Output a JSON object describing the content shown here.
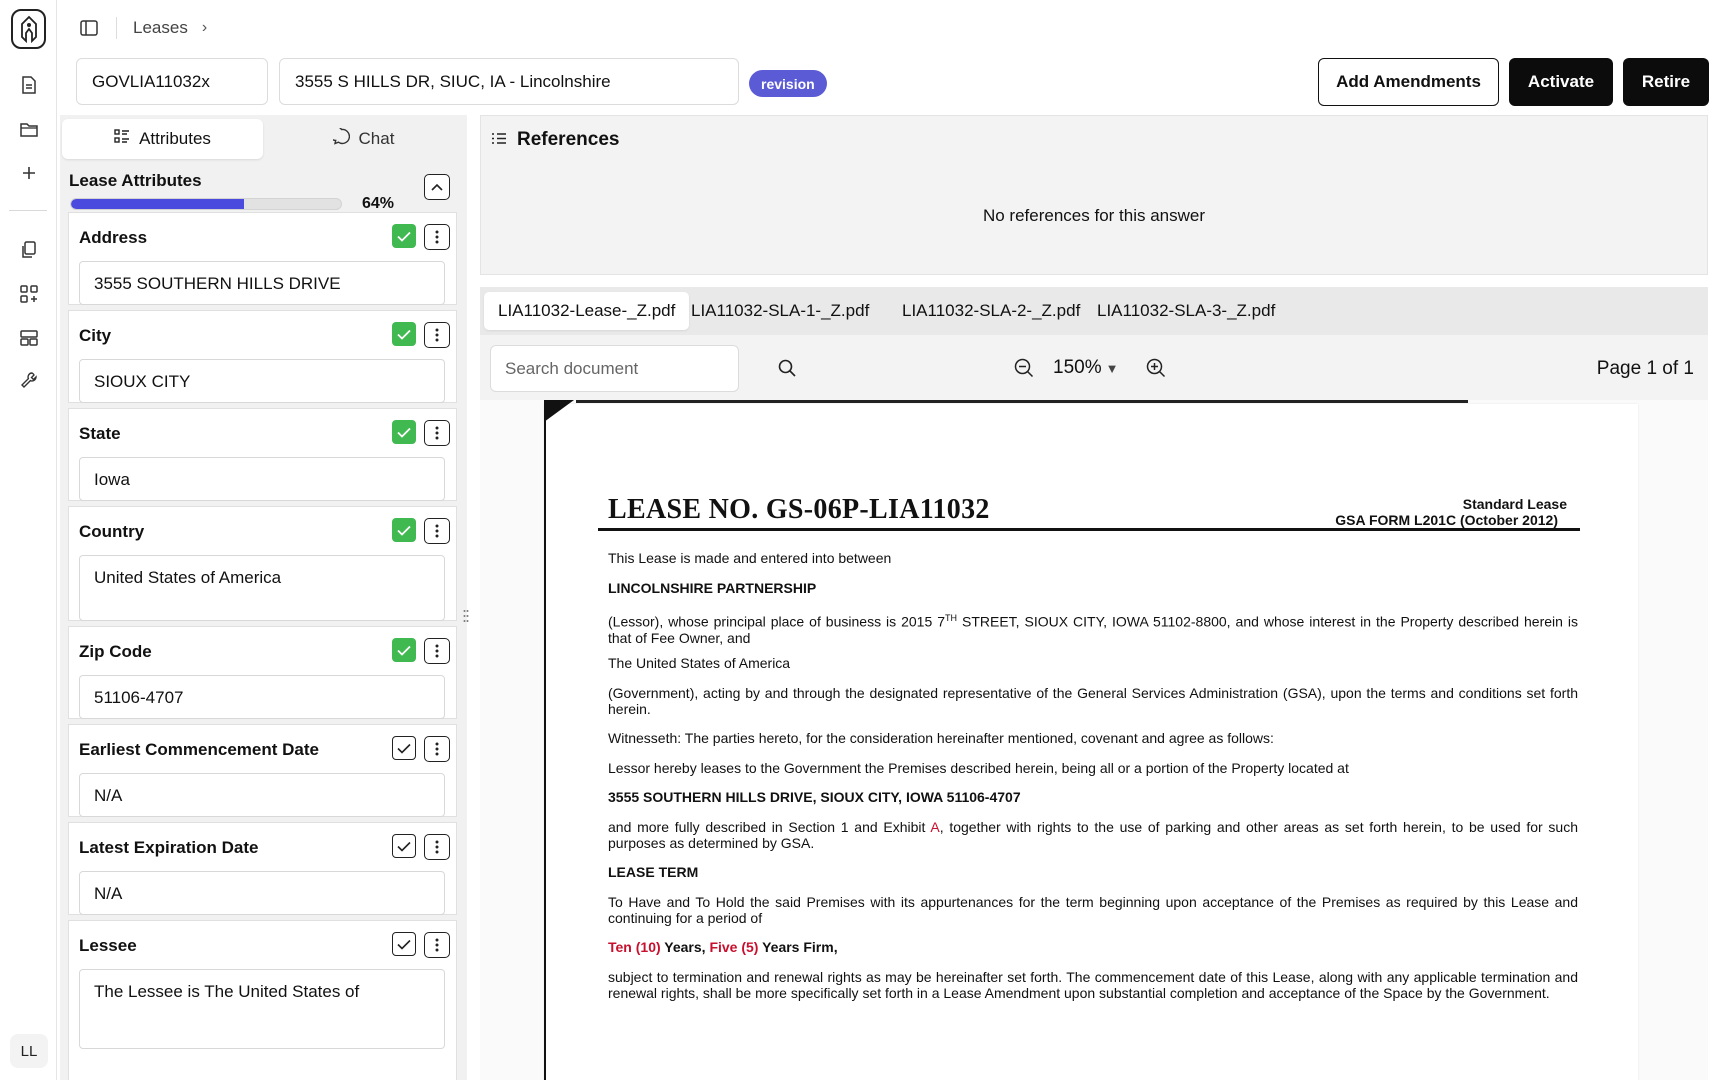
{
  "breadcrumb": {
    "root": "Leases"
  },
  "header": {
    "lease_code": "GOVLIA11032x",
    "property": "3555 S HILLS DR, SIUC, IA - Lincolnshire",
    "status_badge": "revision",
    "actions": {
      "add_amendments": "Add Amendments",
      "activate": "Activate",
      "retire": "Retire"
    }
  },
  "user": {
    "initials": "LL"
  },
  "left_panel": {
    "tabs": {
      "attributes": "Attributes",
      "chat": "Chat"
    },
    "section_title": "Lease Attributes",
    "progress": {
      "percent": 64,
      "label": "64%"
    },
    "fields": [
      {
        "label": "Address",
        "value": "3555 SOUTHERN HILLS DRIVE",
        "verified": true
      },
      {
        "label": "City",
        "value": "SIOUX CITY",
        "verified": true
      },
      {
        "label": "State",
        "value": "Iowa",
        "verified": true
      },
      {
        "label": "Country",
        "value": "United States of America",
        "verified": true
      },
      {
        "label": "Zip Code",
        "value": "51106-4707",
        "verified": true
      },
      {
        "label": "Earliest Commencement Date",
        "value": "N/A",
        "verified": false
      },
      {
        "label": "Latest Expiration Date",
        "value": "N/A",
        "verified": false
      },
      {
        "label": "Lessee",
        "value": "The Lessee is The United States of",
        "verified": false
      }
    ]
  },
  "references": {
    "title": "References",
    "empty_message": "No references for this answer"
  },
  "documents": {
    "tabs": [
      "LIA11032-Lease-_Z.pdf",
      "LIA11032-SLA-1-_Z.pdf",
      "LIA11032-SLA-2-_Z.pdf",
      "LIA11032-SLA-3-_Z.pdf"
    ],
    "active_tab": 0,
    "search_placeholder": "Search document",
    "zoom": "150%",
    "page_info": "Page 1 of 1"
  },
  "document_page": {
    "lease_no": "LEASE NO. GS-06P-LIA11032",
    "form_line1": "Standard Lease",
    "form_line2": "GSA FORM L201C (October 2012)",
    "p1": "This Lease is made and entered into between",
    "p2": "LINCOLNSHIRE PARTNERSHIP",
    "p3_a": "(Lessor), whose principal place of business is 2015 7",
    "p3_sup": "TH",
    "p3_b": " STREET, SIOUX CITY, IOWA 51102-8800, and whose interest in the Property described herein is that of Fee Owner, and",
    "p4": "The United States of America",
    "p5": "(Government), acting by and through the designated representative of the General Services Administration (GSA), upon the terms and conditions set forth herein.",
    "p6": "Witnesseth: The parties hereto, for the consideration hereinafter mentioned, covenant and agree as follows:",
    "p7": "Lessor hereby leases to the Government the Premises described herein, being all or a portion of the Property located at",
    "p8": "3555 SOUTHERN HILLS DRIVE, SIOUX CITY, IOWA 51106-4707",
    "p9_a": "and more fully described in Section 1 and Exhibit ",
    "p9_red": "A",
    "p9_b": ", together with rights to the use of parking and other areas as set forth herein, to be used for such purposes as determined by GSA.",
    "p10": "LEASE TERM",
    "p11": "To Have and To Hold the said Premises with its appurtenances for the term beginning upon acceptance of the Premises as required by this Lease and continuing for a period of",
    "p12_red1": "Ten (10)",
    "p12_a": " Years, ",
    "p12_red2": "Five (5)",
    "p12_b": " Years Firm,",
    "p13": "subject to termination and renewal rights as may be hereinafter set forth.  The commencement date of this Lease, along with any applicable termination and renewal rights, shall be more specifically set forth in a Lease Amendment upon substantial completion and acceptance of the Space by the Government."
  },
  "colors": {
    "accent": "#4a4adf",
    "badge": "#5b5bd6",
    "verified": "#3fb950",
    "highlight_red": "#c8102e"
  }
}
